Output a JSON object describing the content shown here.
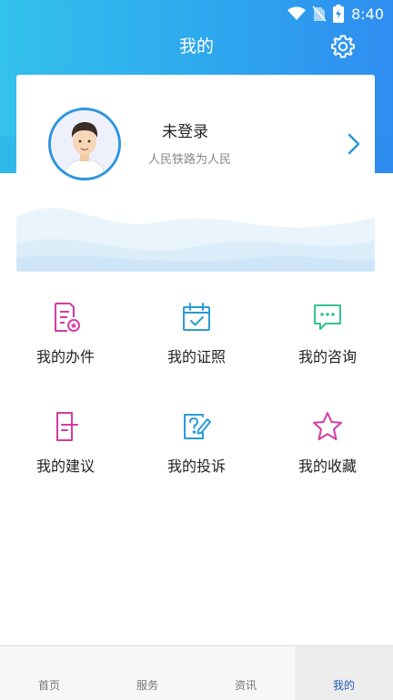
{
  "status_bar": {
    "time": "8:40"
  },
  "header": {
    "title": "我的"
  },
  "profile": {
    "login_status": "未登录",
    "slogan": "人民铁路为人民"
  },
  "grid": {
    "items": [
      {
        "label": "我的办件",
        "icon": "document-badge-icon",
        "color": "#d43ba4"
      },
      {
        "label": "我的证照",
        "icon": "calendar-check-icon",
        "color": "#2c9bd6"
      },
      {
        "label": "我的咨询",
        "icon": "chat-bubble-icon",
        "color": "#36c28f"
      },
      {
        "label": "我的建议",
        "icon": "suggestion-doc-icon",
        "color": "#d43ba4"
      },
      {
        "label": "我的投诉",
        "icon": "complaint-edit-icon",
        "color": "#2c9bd6"
      },
      {
        "label": "我的收藏",
        "icon": "star-icon",
        "color": "#d43ba4"
      }
    ]
  },
  "tabs": [
    {
      "label": "首页",
      "active": false
    },
    {
      "label": "服务",
      "active": false
    },
    {
      "label": "资讯",
      "active": false
    },
    {
      "label": "我的",
      "active": true
    }
  ],
  "colors": {
    "header_start": "#33c2ec",
    "header_end": "#2f8df0",
    "active_tab": "#1f5fb0"
  }
}
